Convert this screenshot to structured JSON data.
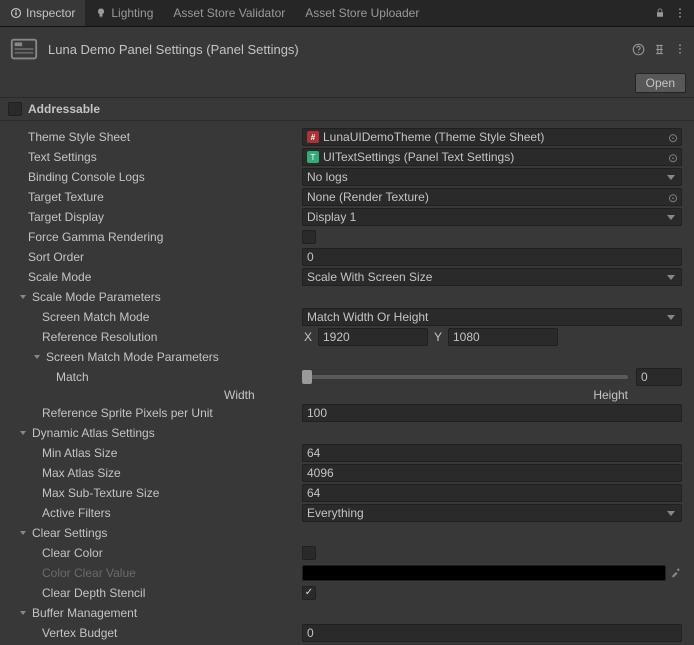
{
  "tabs": {
    "inspector": "Inspector",
    "lighting": "Lighting",
    "validator": "Asset Store Validator",
    "uploader": "Asset Store Uploader"
  },
  "header": {
    "title": "Luna Demo Panel Settings (Panel Settings)",
    "open": "Open"
  },
  "addressable": {
    "label": "Addressable"
  },
  "props": {
    "themeStyleSheet": {
      "label": "Theme Style Sheet",
      "value": "LunaUIDemoTheme (Theme Style Sheet)"
    },
    "textSettings": {
      "label": "Text Settings",
      "value": "UITextSettings (Panel Text Settings)"
    },
    "bindingConsoleLogs": {
      "label": "Binding Console Logs",
      "value": "No logs"
    },
    "targetTexture": {
      "label": "Target Texture",
      "value": "None (Render Texture)"
    },
    "targetDisplay": {
      "label": "Target Display",
      "value": "Display 1"
    },
    "forceGammaRendering": {
      "label": "Force Gamma Rendering"
    },
    "sortOrder": {
      "label": "Sort Order",
      "value": "0"
    },
    "scaleMode": {
      "label": "Scale Mode",
      "value": "Scale With Screen Size"
    },
    "scaleModeParams": {
      "label": "Scale Mode Parameters"
    },
    "screenMatchMode": {
      "label": "Screen Match Mode",
      "value": "Match Width Or Height"
    },
    "referenceResolution": {
      "label": "Reference Resolution",
      "xLabel": "X",
      "x": "1920",
      "yLabel": "Y",
      "y": "1080"
    },
    "screenMatchParams": {
      "label": "Screen Match Mode Parameters"
    },
    "match": {
      "label": "Match",
      "value": "0",
      "leftLabel": "Width",
      "rightLabel": "Height"
    },
    "refSpritePixels": {
      "label": "Reference Sprite Pixels per Unit",
      "value": "100"
    },
    "dynamicAtlas": {
      "label": "Dynamic Atlas Settings"
    },
    "minAtlas": {
      "label": "Min Atlas Size",
      "value": "64"
    },
    "maxAtlas": {
      "label": "Max Atlas Size",
      "value": "4096"
    },
    "maxSubTex": {
      "label": "Max Sub-Texture Size",
      "value": "64"
    },
    "activeFilters": {
      "label": "Active Filters",
      "value": "Everything"
    },
    "clearSettings": {
      "label": "Clear Settings"
    },
    "clearColor": {
      "label": "Clear Color"
    },
    "colorClearValue": {
      "label": "Color Clear Value"
    },
    "clearDepthStencil": {
      "label": "Clear Depth Stencil"
    },
    "bufferMgmt": {
      "label": "Buffer Management"
    },
    "vertexBudget": {
      "label": "Vertex Budget",
      "value": "0"
    }
  }
}
